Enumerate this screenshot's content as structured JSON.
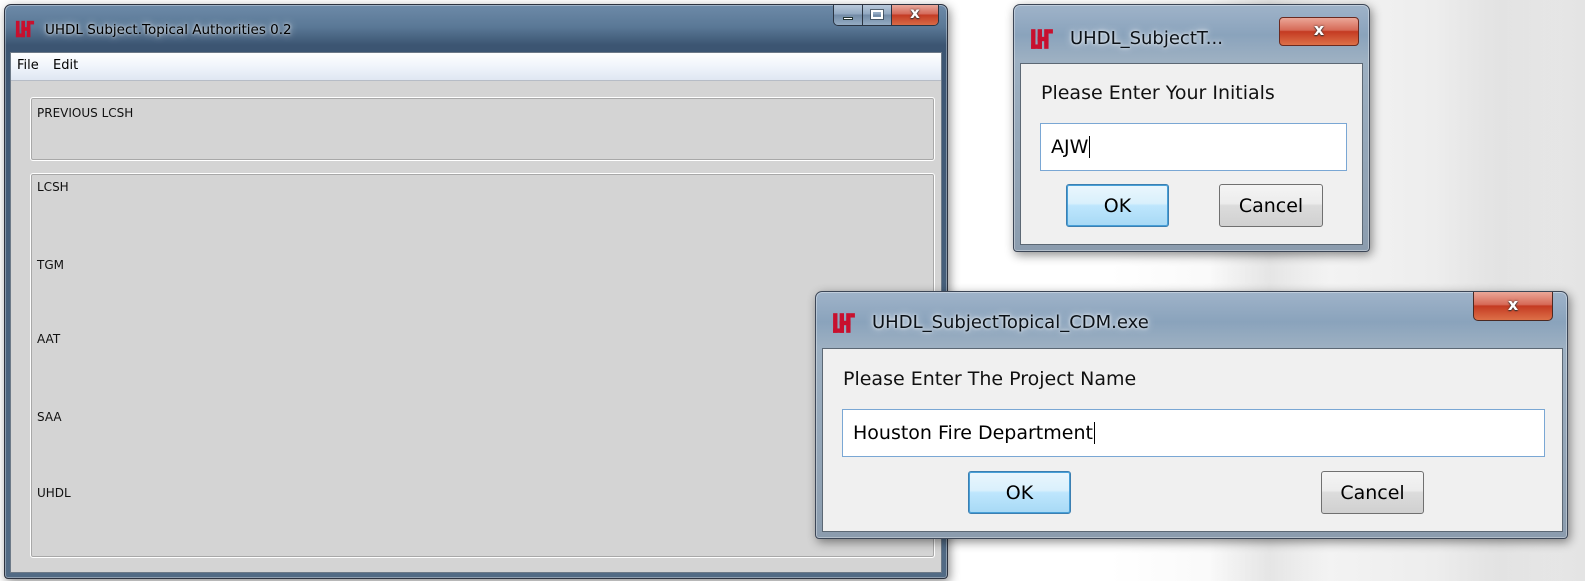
{
  "main_window": {
    "title": "UHDL Subject.Topical Authorities 0.2",
    "menu": [
      "File",
      "Edit"
    ],
    "top_panel_label": "PREVIOUS LCSH",
    "field_labels": [
      "LCSH",
      "TGM",
      "AAT",
      "SAA",
      "UHDL"
    ]
  },
  "initials_dialog": {
    "title": "UHDL_SubjectT...",
    "prompt": "Please Enter Your Initials",
    "value": "AJW",
    "ok_label": "OK",
    "cancel_label": "Cancel"
  },
  "project_dialog": {
    "title": "UHDL_SubjectTopical_CDM.exe",
    "prompt": "Please Enter The Project Name",
    "value": "Houston Fire Department",
    "ok_label": "OK",
    "cancel_label": "Cancel"
  },
  "colors": {
    "logo_red": "#c8102e",
    "window_client": "#d4d4d4",
    "dialog_client": "#f0f0f0"
  },
  "icons": [
    "uh-logo-icon",
    "minimize-icon",
    "maximize-icon",
    "close-icon"
  ]
}
